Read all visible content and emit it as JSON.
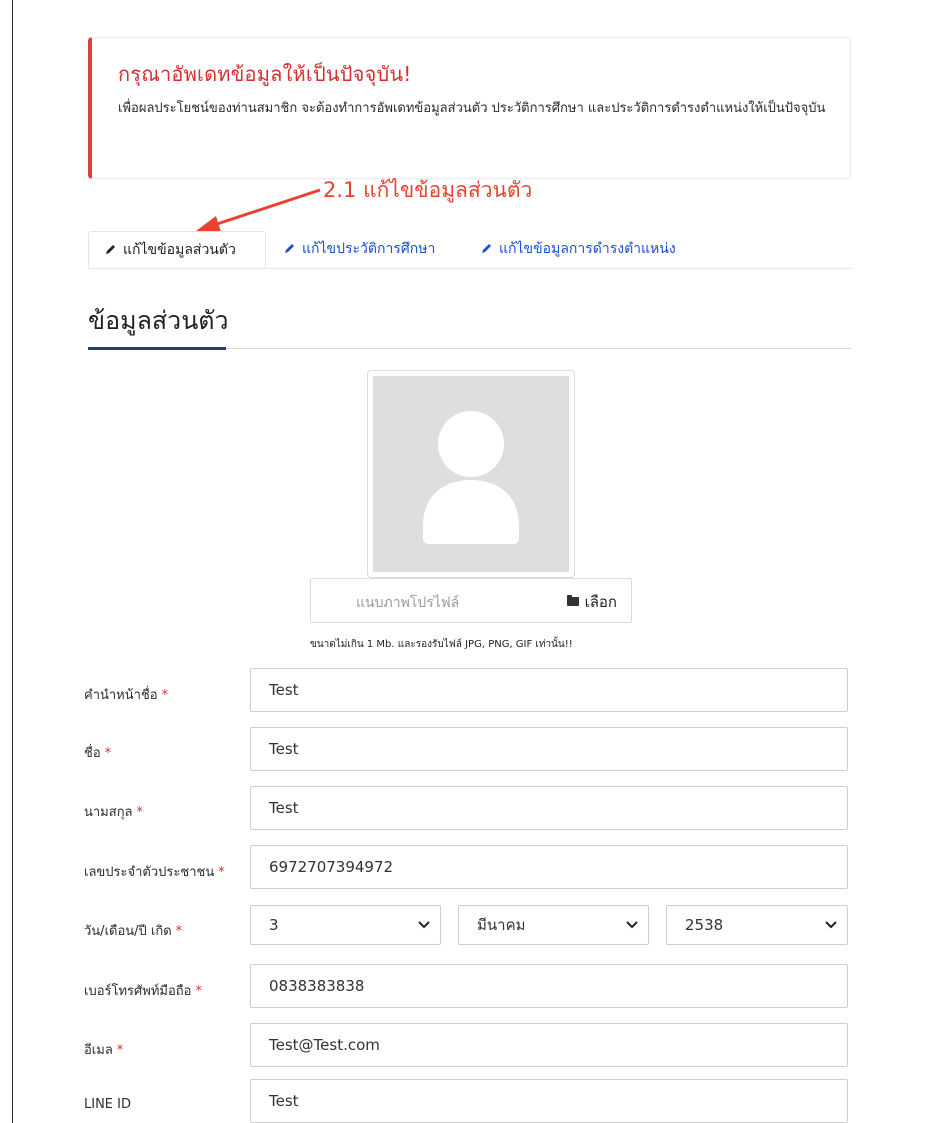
{
  "alert": {
    "title": "กรุณาอัพเดทข้อมูลให้เป็นปัจจุบัน!",
    "text": "เพื่อผลประโยชน์ของท่านสมาชิก จะต้องทำการอัพเดทข้อมูลส่วนตัว ประวัติการศึกษา และประวัติการดำรงตำแหน่งให้เป็นปัจจุบัน"
  },
  "annotation": {
    "text": "2.1 แก้ไขข้อมูลส่วนตัว",
    "color": "#e8432f"
  },
  "tabs": [
    {
      "label": "แก้ไขข้อมูลส่วนตัว",
      "active": true
    },
    {
      "label": "แก้ไขประวัติการศึกษา",
      "active": false
    },
    {
      "label": "แก้ไขข้อมูลการดำรงตำแหน่ง",
      "active": false
    }
  ],
  "section": {
    "title": "ข้อมูลส่วนตัว",
    "accent_color": "#1f3f79"
  },
  "profile": {
    "upload_placeholder": "แนบภาพโปรไฟล์",
    "choose_label": "เลือก",
    "hint": "ขนาดไม่เกิน 1 Mb. และรองรับไฟล์ JPG, PNG, GIF เท่านั้น!!"
  },
  "form": {
    "required_mark": "*",
    "fields": [
      {
        "label": "คำนำหน้าชื่อ",
        "required": true,
        "value": "Test"
      },
      {
        "label": "ชื่อ",
        "required": true,
        "value": "Test"
      },
      {
        "label": "นามสกุล",
        "required": true,
        "value": "Test"
      },
      {
        "label": "เลขประจำตัวประชาชน",
        "required": true,
        "value": "6972707394972"
      },
      {
        "label": "วัน/เดือน/ปี เกิด",
        "required": true,
        "day": "3",
        "month": "มีนาคม",
        "year": "2538"
      },
      {
        "label": "เบอร์โทรศัพท์มือถือ",
        "required": true,
        "value": "0838383838"
      },
      {
        "label": "อีเมล",
        "required": true,
        "value": "Test@Test.com"
      },
      {
        "label": "LINE ID",
        "required": false,
        "value": "Test"
      }
    ]
  },
  "colors": {
    "alert_red": "#d62f2f",
    "link_blue": "#1b4fd6"
  }
}
